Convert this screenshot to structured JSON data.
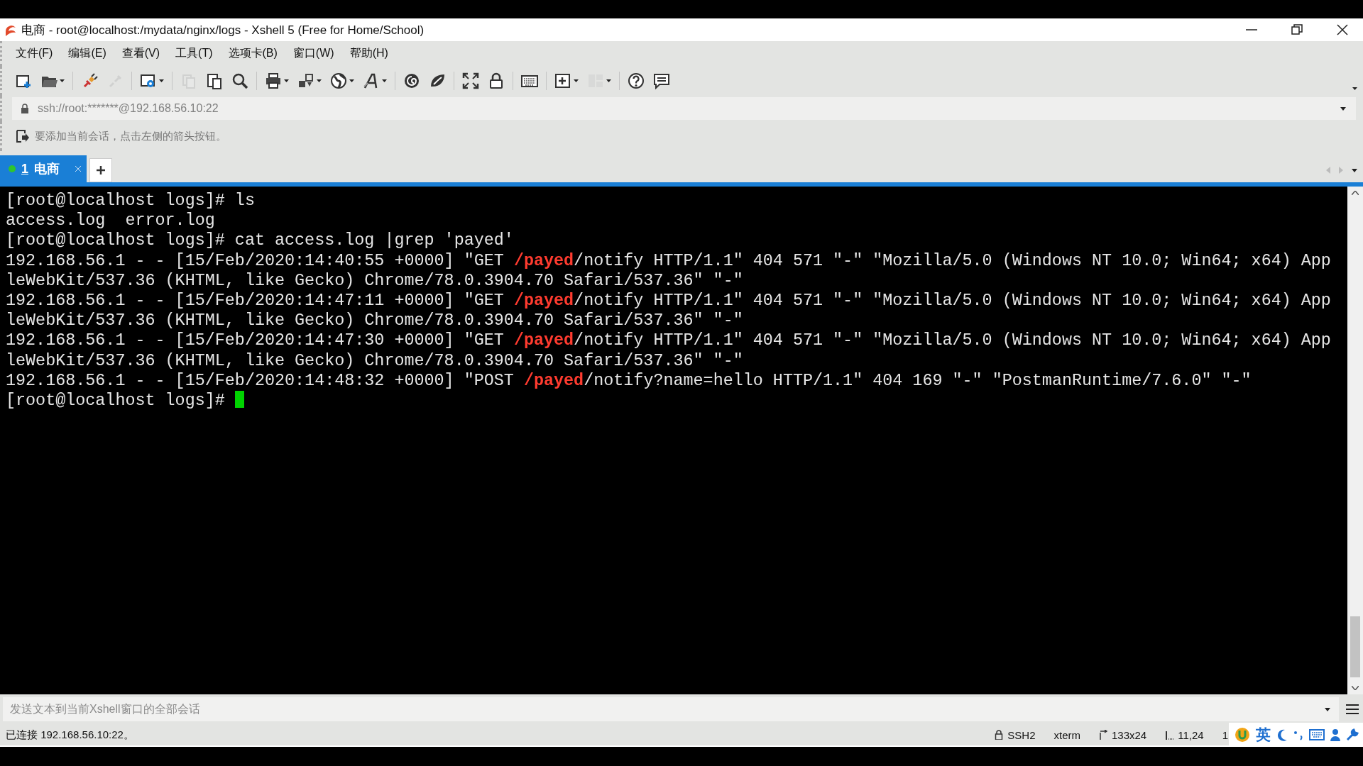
{
  "window": {
    "title": "电商 - root@localhost:/mydata/nginx/logs - Xshell 5 (Free for Home/School)"
  },
  "menu": [
    "文件(F)",
    "编辑(E)",
    "查看(V)",
    "工具(T)",
    "选项卡(B)",
    "窗口(W)",
    "帮助(H)"
  ],
  "toolbar": [
    {
      "kind": "new-session",
      "disabled": false,
      "dropdown": false
    },
    {
      "kind": "open",
      "disabled": false,
      "dropdown": true
    },
    {
      "kind": "sep"
    },
    {
      "kind": "connect",
      "disabled": false,
      "dropdown": false
    },
    {
      "kind": "disconnect",
      "disabled": true,
      "dropdown": false
    },
    {
      "kind": "sep"
    },
    {
      "kind": "properties",
      "disabled": false,
      "dropdown": true
    },
    {
      "kind": "sep"
    },
    {
      "kind": "copy",
      "disabled": true,
      "dropdown": false
    },
    {
      "kind": "paste",
      "disabled": false,
      "dropdown": false
    },
    {
      "kind": "find",
      "disabled": false,
      "dropdown": false
    },
    {
      "kind": "sep"
    },
    {
      "kind": "print",
      "disabled": false,
      "dropdown": true
    },
    {
      "kind": "transfer",
      "disabled": false,
      "dropdown": true
    },
    {
      "kind": "globe",
      "disabled": false,
      "dropdown": true
    },
    {
      "kind": "font",
      "disabled": false,
      "dropdown": true
    },
    {
      "kind": "sep"
    },
    {
      "kind": "swirl",
      "disabled": false,
      "dropdown": false
    },
    {
      "kind": "leaf",
      "disabled": false,
      "dropdown": false
    },
    {
      "kind": "sep"
    },
    {
      "kind": "fullscreen",
      "disabled": false,
      "dropdown": false
    },
    {
      "kind": "lock",
      "disabled": false,
      "dropdown": false
    },
    {
      "kind": "sep"
    },
    {
      "kind": "keyboard",
      "disabled": false,
      "dropdown": false
    },
    {
      "kind": "sep"
    },
    {
      "kind": "new-tab",
      "disabled": false,
      "dropdown": true
    },
    {
      "kind": "layout",
      "disabled": true,
      "dropdown": true
    },
    {
      "kind": "sep"
    },
    {
      "kind": "help",
      "disabled": false,
      "dropdown": false
    },
    {
      "kind": "chat",
      "disabled": false,
      "dropdown": false
    }
  ],
  "address": {
    "value": "ssh://root:*******@192.168.56.10:22"
  },
  "hint": {
    "text": "要添加当前会话，点击左侧的箭头按钮。"
  },
  "tabs": [
    {
      "number": "1",
      "label": "电商",
      "selected": true,
      "connected": true
    }
  ],
  "terminal": {
    "cursor_visible": true,
    "lines": [
      [
        {
          "text": "[root@localhost logs]# ls",
          "highlight": false
        }
      ],
      [
        {
          "text": "access.log  error.log",
          "highlight": false
        }
      ],
      [
        {
          "text": "[root@localhost logs]# cat access.log |grep 'payed'",
          "highlight": false
        }
      ],
      [
        {
          "text": "192.168.56.1 - - [15/Feb/2020:14:40:55 +0000] \"GET ",
          "highlight": false
        },
        {
          "text": "/payed",
          "highlight": true
        },
        {
          "text": "/notify HTTP/1.1\" 404 571 \"-\" \"Mozilla/5.0 (Windows NT 10.0; Win64; x64) App",
          "highlight": false
        }
      ],
      [
        {
          "text": "leWebKit/537.36 (KHTML, like Gecko) Chrome/78.0.3904.70 Safari/537.36\" \"-\"",
          "highlight": false
        }
      ],
      [
        {
          "text": "192.168.56.1 - - [15/Feb/2020:14:47:11 +0000] \"GET ",
          "highlight": false
        },
        {
          "text": "/payed",
          "highlight": true
        },
        {
          "text": "/notify HTTP/1.1\" 404 571 \"-\" \"Mozilla/5.0 (Windows NT 10.0; Win64; x64) App",
          "highlight": false
        }
      ],
      [
        {
          "text": "leWebKit/537.36 (KHTML, like Gecko) Chrome/78.0.3904.70 Safari/537.36\" \"-\"",
          "highlight": false
        }
      ],
      [
        {
          "text": "192.168.56.1 - - [15/Feb/2020:14:47:30 +0000] \"GET ",
          "highlight": false
        },
        {
          "text": "/payed",
          "highlight": true
        },
        {
          "text": "/notify HTTP/1.1\" 404 571 \"-\" \"Mozilla/5.0 (Windows NT 10.0; Win64; x64) App",
          "highlight": false
        }
      ],
      [
        {
          "text": "leWebKit/537.36 (KHTML, like Gecko) Chrome/78.0.3904.70 Safari/537.36\" \"-\"",
          "highlight": false
        }
      ],
      [
        {
          "text": "192.168.56.1 - - [15/Feb/2020:14:48:32 +0000] \"POST ",
          "highlight": false
        },
        {
          "text": "/payed",
          "highlight": true
        },
        {
          "text": "/notify?name=hello HTTP/1.1\" 404 169 \"-\" \"PostmanRuntime/7.6.0\" \"-\"",
          "highlight": false
        }
      ],
      [
        {
          "text": "[root@localhost logs]# ",
          "highlight": false
        }
      ]
    ]
  },
  "send_bar": {
    "placeholder": "发送文本到当前Xshell窗口的全部会话"
  },
  "status_bar": {
    "connection": "已连接 192.168.56.10:22。",
    "items": [
      {
        "kind": "protocol",
        "text": "SSH2"
      },
      {
        "kind": "plain",
        "text": "xterm"
      },
      {
        "kind": "size",
        "text": "133x24"
      },
      {
        "kind": "cursor",
        "text": "11,24"
      },
      {
        "kind": "plain",
        "text": "1"
      }
    ]
  },
  "ime_bar": {
    "mode": "英"
  }
}
